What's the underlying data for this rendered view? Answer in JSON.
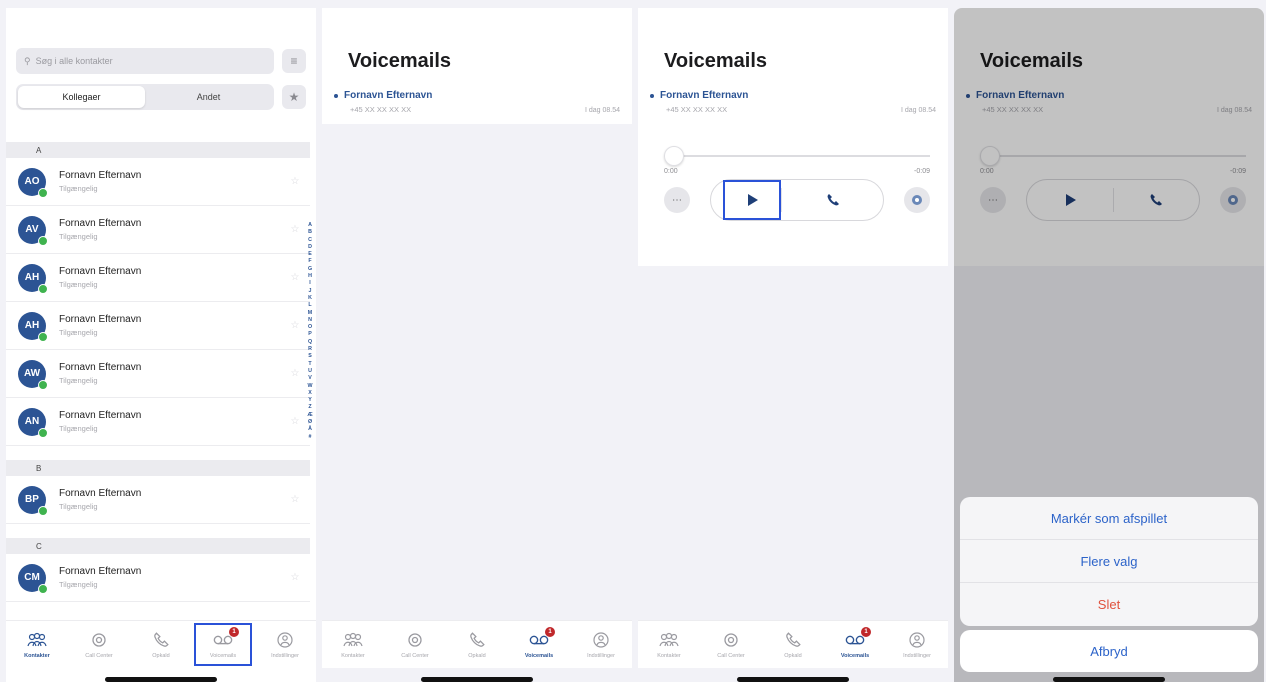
{
  "contacts_screen": {
    "search_placeholder": "Søg i alle kontakter",
    "tabs": [
      "Kollegaer",
      "Andet"
    ],
    "sections": [
      {
        "letter": "A",
        "contacts": [
          {
            "initials": "AO",
            "name": "Fornavn Efternavn",
            "status": "Tilgængelig"
          },
          {
            "initials": "AV",
            "name": "Fornavn Efternavn",
            "status": "Tilgængelig"
          },
          {
            "initials": "AH",
            "name": "Fornavn Efternavn",
            "status": "Tilgængelig"
          },
          {
            "initials": "AH",
            "name": "Fornavn Efternavn",
            "status": "Tilgængelig"
          },
          {
            "initials": "AW",
            "name": "Fornavn Efternavn",
            "status": "Tilgængelig"
          },
          {
            "initials": "AN",
            "name": "Fornavn Efternavn",
            "status": "Tilgængelig"
          }
        ]
      },
      {
        "letter": "B",
        "contacts": [
          {
            "initials": "BP",
            "name": "Fornavn Efternavn",
            "status": "Tilgængelig"
          }
        ]
      },
      {
        "letter": "C",
        "contacts": [
          {
            "initials": "CM",
            "name": "Fornavn Efternavn",
            "status": "Tilgængelig"
          }
        ]
      }
    ],
    "index_letters": [
      "A",
      "B",
      "C",
      "D",
      "E",
      "F",
      "G",
      "H",
      "I",
      "J",
      "K",
      "L",
      "M",
      "N",
      "O",
      "P",
      "Q",
      "R",
      "S",
      "T",
      "U",
      "V",
      "W",
      "X",
      "Y",
      "Z",
      "Æ",
      "Ø",
      "Å",
      "#"
    ]
  },
  "tabbar": {
    "items": [
      {
        "label": "Kontakter",
        "icon": "contacts-icon"
      },
      {
        "label": "Call Center",
        "icon": "call-center-icon"
      },
      {
        "label": "Opkald",
        "icon": "phone-icon"
      },
      {
        "label": "Voicemails",
        "icon": "voicemail-icon",
        "badge": "1"
      },
      {
        "label": "Indstillinger",
        "icon": "settings-icon"
      }
    ]
  },
  "voicemails": {
    "title": "Voicemails",
    "item": {
      "name": "Fornavn Efternavn",
      "number": "+45 XX XX XX XX",
      "time": "I dag 08.54"
    },
    "player": {
      "elapsed": "0:00",
      "remaining": "-0:09"
    }
  },
  "action_sheet": {
    "options": [
      "Markér som afspillet",
      "Flere valg",
      "Slet"
    ],
    "cancel": "Afbryd"
  },
  "colors": {
    "brand": "#2c5494",
    "presence": "#3fb34f",
    "badge": "#c0282b",
    "focus": "#2a52d8",
    "destructive": "#e0523e"
  }
}
